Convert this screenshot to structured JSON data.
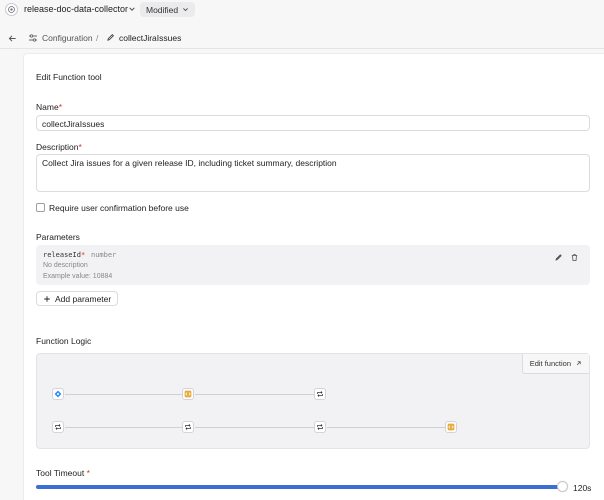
{
  "topbar": {
    "app_name": "release-doc-data-collector",
    "status": "Modified"
  },
  "breadcrumb": {
    "parent": "Configuration",
    "separator": "/",
    "current": "collectJiraIssues"
  },
  "form": {
    "heading": "Edit Function tool",
    "name_label": "Name",
    "name_value": "collectJiraIssues",
    "description_label": "Description",
    "description_value": "Collect Jira issues for a given release ID, including ticket summary, description",
    "confirm_label": "Require user confirmation before use",
    "confirm_checked": false,
    "required_mark": "*"
  },
  "parameters": {
    "heading": "Parameters",
    "items": [
      {
        "name": "releaseId",
        "required_mark": "*",
        "type": "number",
        "description": "No description",
        "example": "Example value: 10884"
      }
    ],
    "add_label": "Add parameter"
  },
  "logic": {
    "heading": "Function Logic",
    "edit_label": "Edit function",
    "nodes": [
      {
        "icon": "jira-icon",
        "row": 1,
        "col": 1
      },
      {
        "icon": "code-block-icon",
        "row": 1,
        "col": 2
      },
      {
        "icon": "loop-icon",
        "row": 1,
        "col": 3
      },
      {
        "icon": "loop-icon",
        "row": 2,
        "col": 1
      },
      {
        "icon": "loop-icon",
        "row": 2,
        "col": 2
      },
      {
        "icon": "loop-icon",
        "row": 2,
        "col": 3
      },
      {
        "icon": "code-block-icon",
        "row": 2,
        "col": 4
      }
    ]
  },
  "timeout": {
    "label": "Tool Timeout",
    "required_mark": "*",
    "value_label": "120s",
    "fill_fraction": 0.99
  },
  "colors": {
    "accent": "#3b6fd6",
    "required": "#d32f2f",
    "jira": "#2684ff",
    "code_block": "#e8a93a"
  }
}
